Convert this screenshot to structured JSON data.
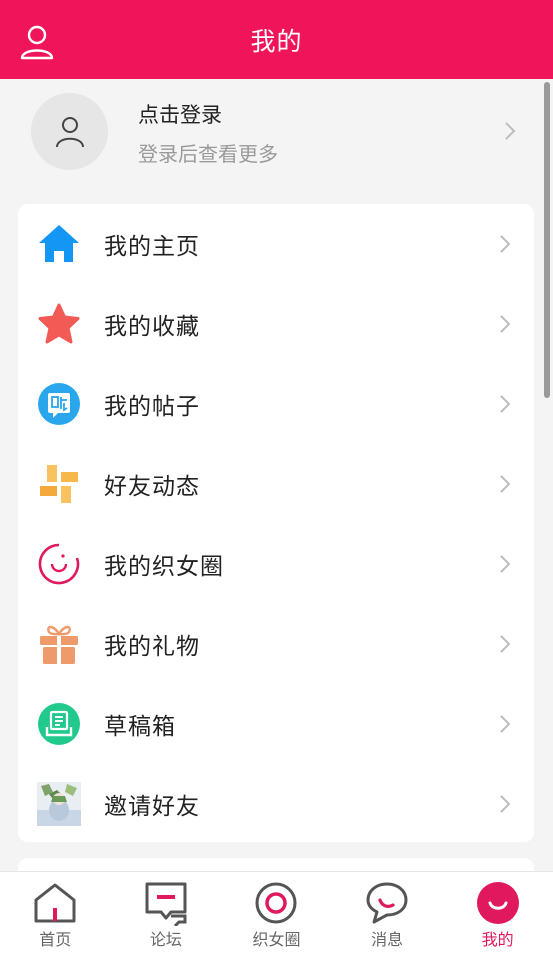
{
  "header": {
    "title": "我的",
    "user_icon": "user-icon"
  },
  "login": {
    "title": "点击登录",
    "subtitle": "登录后查看更多"
  },
  "menu": [
    {
      "label": "我的主页",
      "icon": "home-icon",
      "color": "#1496f5"
    },
    {
      "label": "我的收藏",
      "icon": "star-icon",
      "color": "#f25a55"
    },
    {
      "label": "我的帖子",
      "icon": "post-icon",
      "color": "#2aa6ec"
    },
    {
      "label": "好友动态",
      "icon": "pinwheel-icon",
      "color": "#f7b84b"
    },
    {
      "label": "我的织女圈",
      "icon": "circle-icon",
      "color": "#e0185e"
    },
    {
      "label": "我的礼物",
      "icon": "gift-icon",
      "color": "#ef9a6a"
    },
    {
      "label": "草稿箱",
      "icon": "draft-icon",
      "color": "#21c98c"
    },
    {
      "label": "邀请好友",
      "icon": "invite-image-icon",
      "color": "#c9d6e6"
    }
  ],
  "tabs": [
    {
      "label": "首页",
      "icon": "home-tab-icon"
    },
    {
      "label": "论坛",
      "icon": "forum-tab-icon"
    },
    {
      "label": "织女圈",
      "icon": "circle-tab-icon"
    },
    {
      "label": "消息",
      "icon": "message-tab-icon"
    },
    {
      "label": "我的",
      "icon": "mine-tab-icon",
      "active": true
    }
  ],
  "colors": {
    "accent": "#f0155a",
    "active_tab": "#e0185e"
  }
}
